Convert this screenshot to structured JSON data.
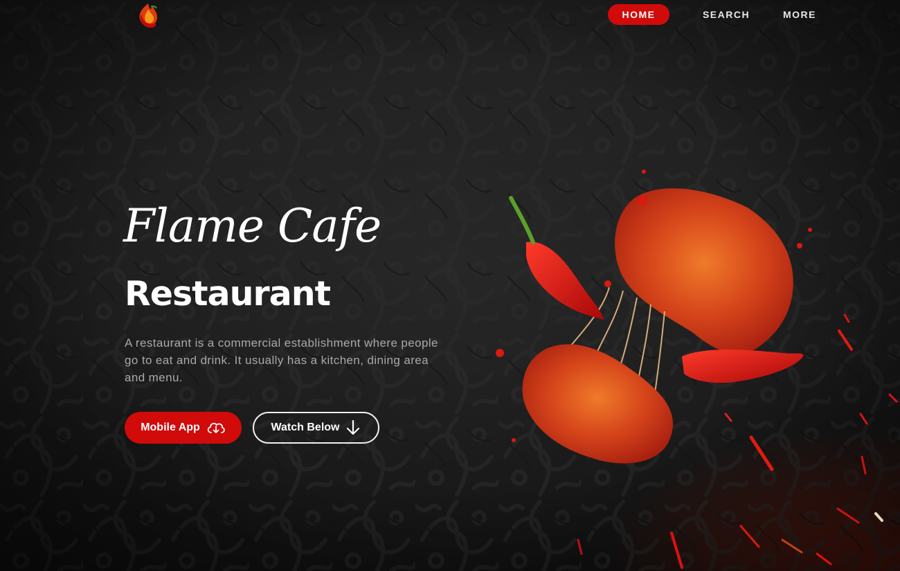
{
  "brand": {
    "logo_icon": "flame-chili-logo-icon"
  },
  "nav": {
    "items": [
      {
        "label": "HOME",
        "active": true
      },
      {
        "label": "SEARCH",
        "active": false
      },
      {
        "label": "MORE",
        "active": false
      }
    ]
  },
  "hero": {
    "script_title": "Flame Cafe",
    "title": "Restaurant",
    "description": "A restaurant is a commercial establishment where people go to eat and drink. It usually has a kitchen, dining area and menu.",
    "buttons": {
      "app": {
        "label": "Mobile App",
        "icon": "cloud-download-icon"
      },
      "watch": {
        "label": "Watch Below",
        "icon": "arrow-down-icon"
      }
    },
    "image": {
      "subject": "chicken-pieces-with-chili-peppers"
    }
  },
  "colors": {
    "accent": "#d10a0a",
    "background": "#1a1a1a",
    "text": "#ffffff",
    "muted_text": "#a9a9a9"
  }
}
